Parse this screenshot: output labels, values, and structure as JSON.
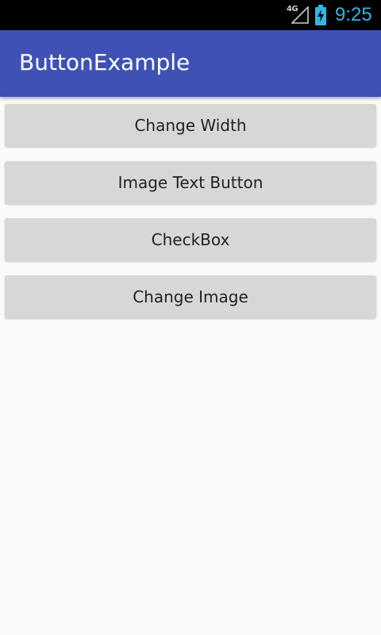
{
  "status_bar": {
    "network_label": "4G",
    "time": "9:25",
    "icons": [
      "signal-icon",
      "battery-charging-icon"
    ]
  },
  "app_bar": {
    "title": "ButtonExample"
  },
  "buttons": [
    {
      "label": "Change Width"
    },
    {
      "label": "Image Text Button"
    },
    {
      "label": "CheckBox"
    },
    {
      "label": "Change Image"
    }
  ],
  "colors": {
    "app_bar": "#3f51b5",
    "status_bar": "#000000",
    "clock": "#33b5e5",
    "button": "#d6d7d7",
    "background": "#fafafa"
  }
}
